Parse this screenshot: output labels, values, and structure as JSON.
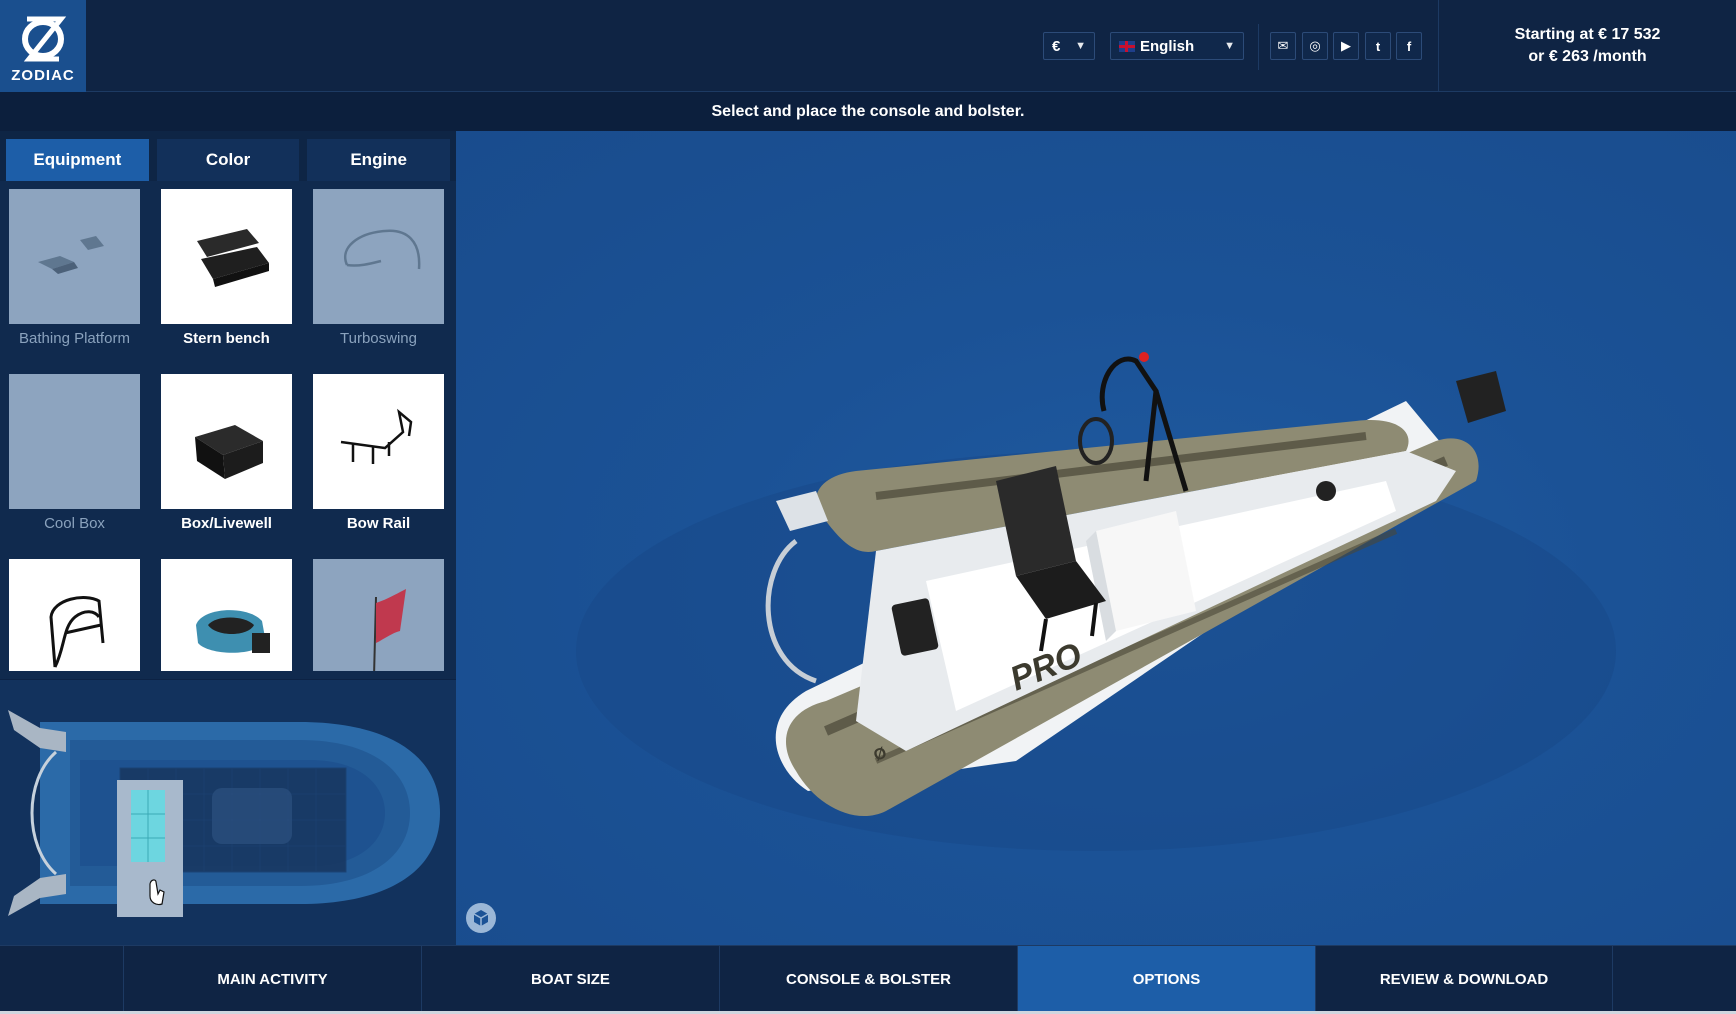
{
  "brand": {
    "logo_text": "ZODIAC"
  },
  "header": {
    "currency": "€",
    "language": "English",
    "social": [
      {
        "icon": "envelope-icon",
        "glyph": "✉"
      },
      {
        "icon": "instagram-icon",
        "glyph": "◎"
      },
      {
        "icon": "youtube-icon",
        "glyph": "▶"
      },
      {
        "icon": "twitter-icon",
        "glyph": "t"
      },
      {
        "icon": "facebook-icon",
        "glyph": "f"
      }
    ],
    "price_line1": "Starting at € 17 532",
    "price_line2": "or € 263 /month"
  },
  "instruction": "Select and place the console and bolster.",
  "tabs": [
    "Equipment",
    "Color",
    "Engine"
  ],
  "options": [
    {
      "label": "Bathing Platform",
      "enabled": false,
      "icon": "bathing-platform-icon"
    },
    {
      "label": "Stern bench",
      "enabled": true,
      "icon": "stern-bench-icon"
    },
    {
      "label": "Turboswing",
      "enabled": false,
      "icon": "turboswing-icon"
    },
    {
      "label": "Cool Box",
      "enabled": false,
      "icon": "cool-box-icon"
    },
    {
      "label": "Box/Livewell",
      "enabled": true,
      "icon": "box-livewell-icon"
    },
    {
      "label": "Bow Rail",
      "enabled": true,
      "icon": "bow-rail-icon"
    },
    {
      "label": "",
      "enabled": true,
      "icon": "t-top-frame-icon"
    },
    {
      "label": "",
      "enabled": true,
      "icon": "console-seat-icon"
    },
    {
      "label": "",
      "enabled": false,
      "icon": "flag-icon"
    }
  ],
  "boat_text": "PRO",
  "steps": [
    "MAIN ACTIVITY",
    "BOAT SIZE",
    "CONSOLE & BOLSTER",
    "OPTIONS",
    "REVIEW & DOWNLOAD"
  ],
  "active_step": "OPTIONS",
  "colors": {
    "header_bg": "#0f2444",
    "accent": "#1d5ea8",
    "viewport_bg": "#1b5296"
  }
}
